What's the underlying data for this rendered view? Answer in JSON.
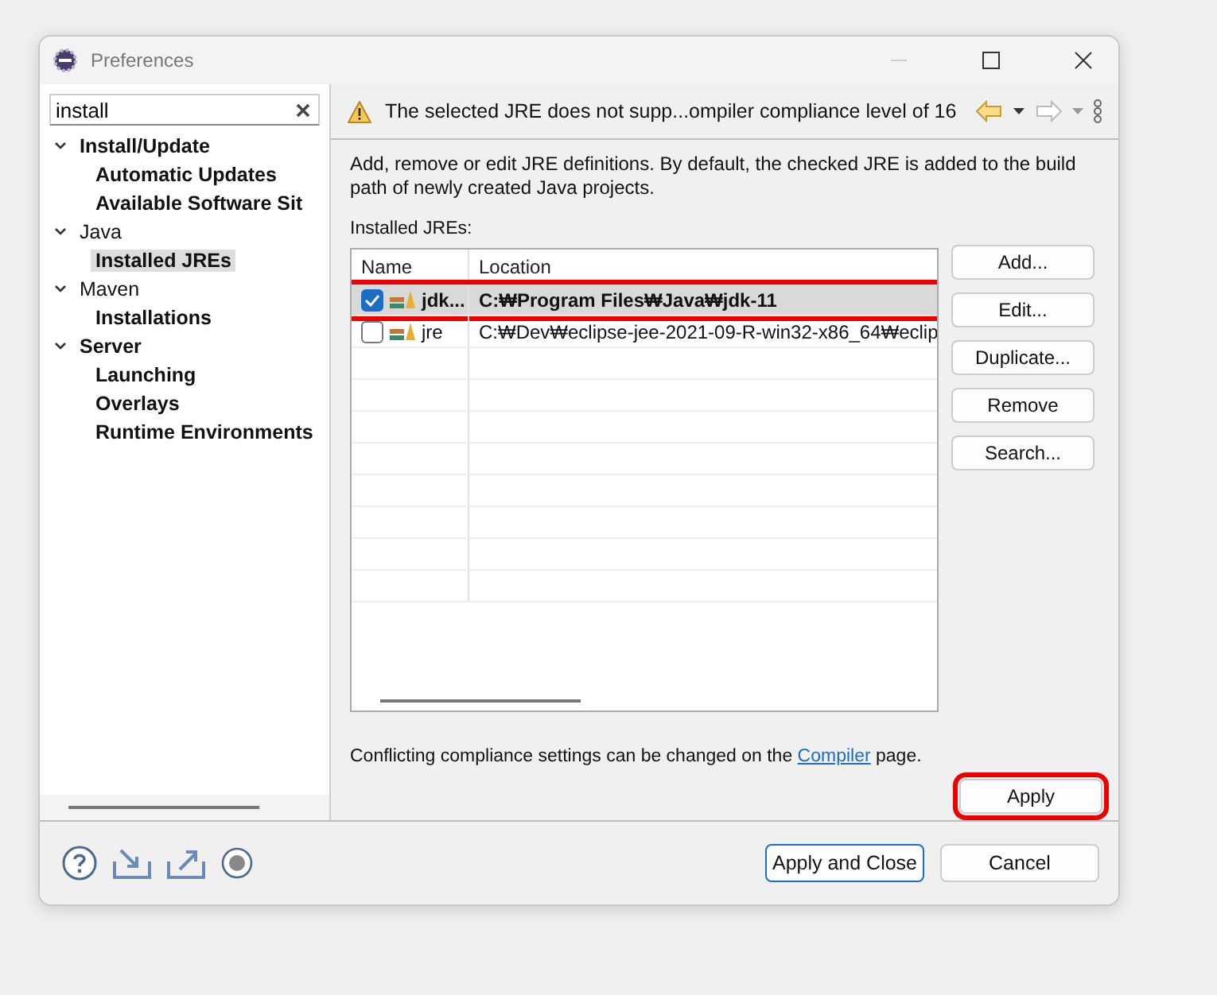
{
  "window": {
    "title": "Preferences"
  },
  "filter": {
    "value": "install"
  },
  "tree": [
    {
      "label": "Install/Update",
      "expanded": true,
      "matched": true,
      "selected": false,
      "children": [
        {
          "label": "Automatic Updates",
          "matched": true,
          "selected": false
        },
        {
          "label": "Available Software Sit",
          "matched": true,
          "selected": false
        }
      ]
    },
    {
      "label": "Java",
      "expanded": true,
      "matched": false,
      "selected": false,
      "children": [
        {
          "label": "Installed JREs",
          "matched": true,
          "selected": true
        }
      ]
    },
    {
      "label": "Maven",
      "expanded": true,
      "matched": false,
      "selected": false,
      "children": [
        {
          "label": "Installations",
          "matched": true,
          "selected": false
        }
      ]
    },
    {
      "label": "Server",
      "expanded": true,
      "matched": true,
      "selected": false,
      "children": [
        {
          "label": "Launching",
          "matched": true,
          "selected": false
        },
        {
          "label": "Overlays",
          "matched": true,
          "selected": false
        },
        {
          "label": "Runtime Environments",
          "matched": true,
          "selected": false
        }
      ]
    }
  ],
  "message": "The selected JRE does not supp...ompiler compliance level of 16",
  "description": "Add, remove or edit JRE definitions. By default, the checked JRE is added to the build path of newly created Java projects.",
  "jre_table": {
    "label": "Installed JREs:",
    "columns": [
      "Name",
      "Location"
    ],
    "rows": [
      {
        "name": "jdk...",
        "location": "C:₩Program Files₩Java₩jdk-11",
        "checked": true,
        "selected": true,
        "highlighted": true
      },
      {
        "name": "jre",
        "location": "C:₩Dev₩eclipse-jee-2021-09-R-win32-x86_64₩eclip",
        "checked": false,
        "selected": false,
        "highlighted": false
      }
    ]
  },
  "side_buttons": [
    "Add...",
    "Edit...",
    "Duplicate...",
    "Remove",
    "Search..."
  ],
  "compiler_note": {
    "before": "Conflicting compliance settings can be changed on the ",
    "link": "Compiler",
    "after": " page."
  },
  "apply_button": {
    "label": "Apply",
    "highlighted": true
  },
  "footer_buttons": [
    {
      "label": "Apply and Close",
      "kind": "default"
    },
    {
      "label": "Cancel",
      "kind": "normal"
    }
  ]
}
